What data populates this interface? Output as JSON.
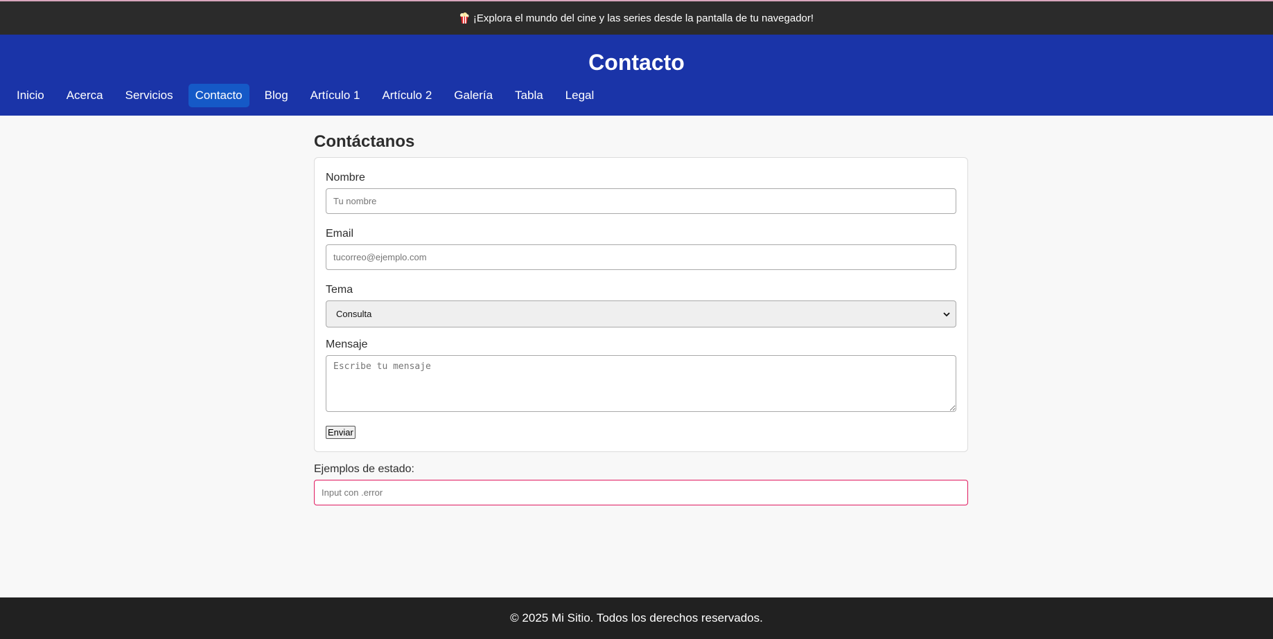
{
  "banner": {
    "icon": "popcorn-icon",
    "text": "¡Explora el mundo del cine y las series desde la pantalla de tu navegador!"
  },
  "header": {
    "title": "Contacto"
  },
  "nav": {
    "items": [
      {
        "label": "Inicio"
      },
      {
        "label": "Acerca"
      },
      {
        "label": "Servicios"
      },
      {
        "label": "Contacto",
        "active": true
      },
      {
        "label": "Blog"
      },
      {
        "label": "Artículo 1"
      },
      {
        "label": "Artículo 2"
      },
      {
        "label": "Galería"
      },
      {
        "label": "Tabla"
      },
      {
        "label": "Legal"
      }
    ]
  },
  "form": {
    "heading": "Contáctanos",
    "name_label": "Nombre",
    "name_placeholder": "Tu nombre",
    "email_label": "Email",
    "email_placeholder": "tucorreo@ejemplo.com",
    "topic_label": "Tema",
    "topic_selected": "Consulta",
    "message_label": "Mensaje",
    "message_placeholder": "Escribe tu mensaje",
    "submit_label": "Enviar"
  },
  "status": {
    "label": "Ejemplos de estado:",
    "error_placeholder": "Input con .error"
  },
  "footer": {
    "text": "© 2025 Mi Sitio. Todos los derechos reservados."
  },
  "colors": {
    "header_bg": "#1a34a8",
    "active_nav": "#1559c7",
    "banner_bg": "#2b2b2b",
    "footer_bg": "#212121",
    "error_border": "#e0185e"
  }
}
